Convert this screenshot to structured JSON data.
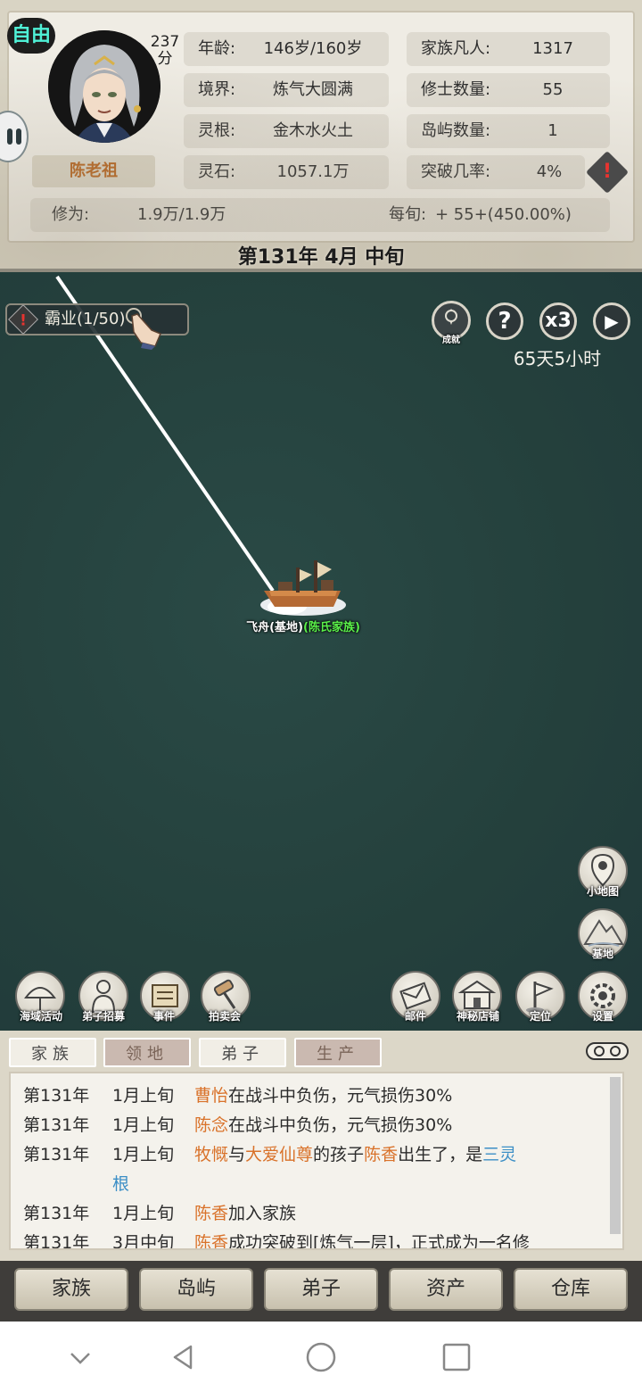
{
  "header": {
    "mode_badge": "自由",
    "score_value": "237",
    "score_unit": "分",
    "character_name": "陈老祖",
    "stats_left": [
      {
        "label": "年龄:",
        "value": "146岁/160岁"
      },
      {
        "label": "境界:",
        "value": "炼气大圆满"
      },
      {
        "label": "灵根:",
        "value": "金木水火土"
      },
      {
        "label": "灵石:",
        "value": "1057.1万"
      }
    ],
    "stats_right": [
      {
        "label": "家族凡人:",
        "value": "1317"
      },
      {
        "label": "修士数量:",
        "value": "55"
      },
      {
        "label": "岛屿数量:",
        "value": "1"
      },
      {
        "label": "突破几率:",
        "value": "4%"
      }
    ],
    "cultivation_label": "修为:",
    "cultivation_value": "1.9万/1.9万",
    "per_period_label": "每旬:",
    "per_period_value": "+ 55+(450.00%)",
    "date": "第131年 4月 中旬",
    "warn_mark": "!"
  },
  "map": {
    "quest_label": "霸业(1/50)",
    "quest_warn": "!",
    "controls": {
      "achievement_caption": "成就",
      "help_symbol": "?",
      "speed_label": "x3",
      "play_symbol": "▶"
    },
    "timer": "65天5小时",
    "ship_name": "飞舟(基地)",
    "ship_clan": "(陈氏家族)",
    "right_icons": [
      {
        "name": "minimap",
        "caption": "小地图"
      },
      {
        "name": "base",
        "caption": "基地"
      }
    ],
    "bottom_left_icons": [
      {
        "name": "sea-activity",
        "caption": "海域活动"
      },
      {
        "name": "disciple-recruit",
        "caption": "弟子招募"
      },
      {
        "name": "events",
        "caption": "事件"
      },
      {
        "name": "auction",
        "caption": "拍卖会"
      }
    ],
    "bottom_right_icons": [
      {
        "name": "mail",
        "caption": "邮件"
      },
      {
        "name": "mystery-shop",
        "caption": "神秘店铺"
      },
      {
        "name": "locate",
        "caption": "定位"
      },
      {
        "name": "settings",
        "caption": "设置"
      }
    ]
  },
  "log": {
    "tabs": [
      "家族",
      "领地",
      "弟子",
      "生产"
    ],
    "entries": [
      {
        "year": "第131年",
        "month": "1月上旬",
        "name": "曹怡",
        "text": "在战斗中负伤，元气损伤30%"
      },
      {
        "year": "第131年",
        "month": "1月上旬",
        "name": "陈念",
        "text": "在战斗中负伤，元气损伤30%"
      },
      {
        "year": "第131年",
        "month": "1月上旬",
        "name": "牧慨",
        "mid": "与",
        "name2": "大爱仙尊",
        "text2": "的孩子",
        "name3": "陈香",
        "text3": "出生了，是",
        "root": "三灵",
        "root2": "根"
      },
      {
        "year": "第131年",
        "month": "1月上旬",
        "name": "陈香",
        "text": "加入家族"
      },
      {
        "year": "第131年",
        "month": "3月中旬",
        "name": "陈香",
        "text": "成功突破到[炼气一层]，正式成为一名修"
      }
    ]
  },
  "nav": {
    "buttons": [
      "家族",
      "岛屿",
      "弟子",
      "资产",
      "仓库"
    ]
  }
}
